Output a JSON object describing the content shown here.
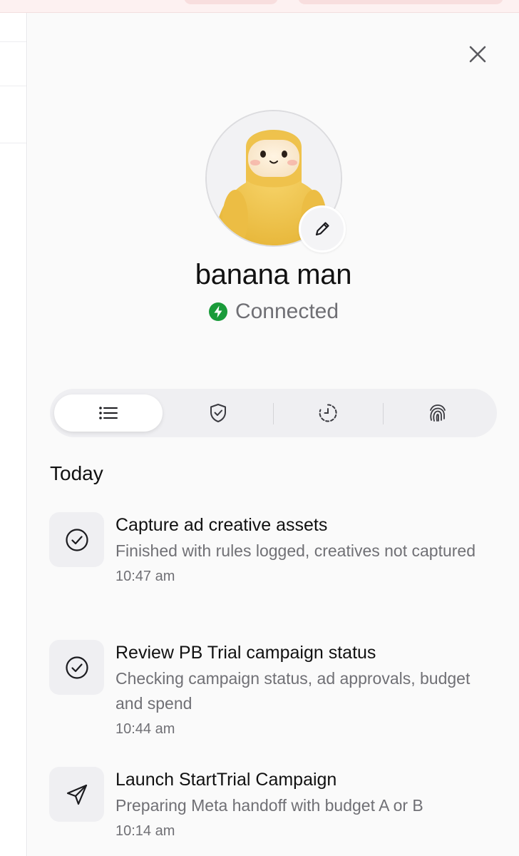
{
  "profile": {
    "name": "banana man",
    "status": "Connected",
    "status_color": "#1a9b3a"
  },
  "tabs": [
    {
      "icon": "list-icon",
      "active": true
    },
    {
      "icon": "shield-check-icon",
      "active": false
    },
    {
      "icon": "clock-icon",
      "active": false
    },
    {
      "icon": "fingerprint-icon",
      "active": false
    }
  ],
  "activity": {
    "section_title": "Today",
    "items": [
      {
        "icon": "check-circle-icon",
        "title": "Capture ad creative assets",
        "description": "Finished with rules logged, creatives not captured",
        "time": "10:47 am"
      },
      {
        "icon": "check-circle-icon",
        "title": "Review PB Trial campaign status",
        "description": "Checking campaign status, ad approvals, budget and spend",
        "time": "10:44 am"
      },
      {
        "icon": "send-icon",
        "title": "Launch StartTrial Campaign",
        "description": "Preparing Meta handoff with budget A or B",
        "time": "10:14 am"
      }
    ]
  }
}
